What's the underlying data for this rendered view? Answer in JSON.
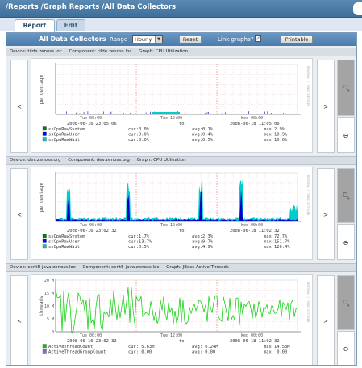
{
  "breadcrumb": "/Reports /Graph Reports /All Data Collectors",
  "tabs": {
    "active": "Report",
    "inactive": "Edit"
  },
  "toolbar": {
    "title": "All Data Collectors",
    "range_label": "Range",
    "range_value": "Hourly",
    "reset_label": "Reset",
    "link_graphs_label": "Link graphs?",
    "link_graphs_checked": true,
    "printable_label": "Printable"
  },
  "nav": {
    "prev": "<",
    "next": ">",
    "zoom_in_icon": "zoom-in-icon",
    "zoom_out_icon": "zoom-out-icon"
  },
  "sections": [
    {
      "device": "Device: tilde.zenoss.loc",
      "component": "Component: tilde.zenoss.loc",
      "graph": "Graph: CPU Utilization",
      "ylabel": "percentage",
      "y_ticks": [],
      "x_ticks": [
        "Tue 00:00",
        "Tue 12:00",
        "Wed 00:00"
      ],
      "date_from": "2008-06-16 23:05:06",
      "to": "to",
      "date_to": "2008-06-18 11:05:06",
      "vertical_text": "RRDTOOL / TOBI OETIKER",
      "legend": [
        {
          "name": "ssCpuRawSystem",
          "cur": "cur:0.0%",
          "avg": "avg:0.1%",
          "max": "max:2.9%",
          "color": "#008000"
        },
        {
          "name": "ssCpuRawUser",
          "cur": "cur:0.0%",
          "avg": "avg:0.4%",
          "max": "max:10.9%",
          "color": "#0000ff"
        },
        {
          "name": "ssCpuRawWait",
          "cur": "cur:0.0%",
          "avg": "avg:0.5%",
          "max": "max:10.0%",
          "color": "#00cccc"
        }
      ]
    },
    {
      "device": "Device: dev.zenoss.org",
      "component": "Component: dev.zenoss.org",
      "graph": "Graph: CPU Utilization",
      "ylabel": "percentage",
      "y_ticks": [],
      "x_ticks": [
        "Tue 00:00",
        "Tue 12:00",
        "Wed 00:00"
      ],
      "date_from": "2008-06-16 23:02:32",
      "to": "to",
      "date_to": "2008-06-18 11:02:32",
      "vertical_text": "RRDTOOL / TOBI OETIKER",
      "legend": [
        {
          "name": "ssCpuRawSystem",
          "cur": "cur:1.7%",
          "avg": "avg:2.3%",
          "max": "max:72.7%",
          "color": "#008000"
        },
        {
          "name": "ssCpuRawUser",
          "cur": "cur:13.7%",
          "avg": "avg:9.7%",
          "max": "max:151.7%",
          "color": "#0000ff"
        },
        {
          "name": "ssCpuRawWait",
          "cur": "cur:0.5%",
          "avg": "avg:4.9%",
          "max": "max:126.4%",
          "color": "#00cccc"
        }
      ]
    },
    {
      "device": "Device: cent5-java.zenoss.loc",
      "component": "Component: cent5-java.zenoss.loc",
      "graph": "Graph: JBoss Active Threads",
      "ylabel": "threads",
      "y_ticks": [
        "20 M",
        "15 M",
        "10 M",
        "5 M",
        "0"
      ],
      "x_ticks": [
        "Tue 00:00",
        "Tue 12:00",
        "Wed 00:00"
      ],
      "date_from": "2008-06-16 23:02:32",
      "to": "to",
      "date_to": "2008-06-18 11:02:32",
      "vertical_text": "RRDTOOL / TOBI OETIKER",
      "legend": [
        {
          "name": "ActiveThreadCount",
          "cur": "cur: 5.63m",
          "avg": "avg: 6.24M",
          "max": "max:14.53M",
          "color": "#00cc00"
        },
        {
          "name": "ActiveThreadGroupCount",
          "cur": "cur: 0.00",
          "avg": "avg: 0.00",
          "max": "max: 0.00",
          "color": "#9966cc"
        }
      ]
    }
  ]
}
